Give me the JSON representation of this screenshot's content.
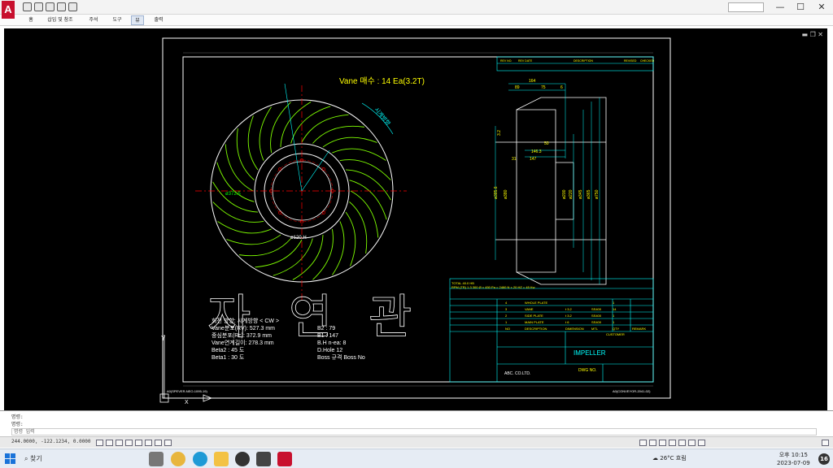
{
  "titlebar": {
    "logo": "A",
    "controls": [
      "—",
      "☐",
      "✕"
    ]
  },
  "ribbon": {
    "tabs": [
      "홈",
      "삽입 및 참조",
      "주석",
      "도구",
      "뷰",
      "출력"
    ],
    "active_tab": 4
  },
  "viewport": {
    "controls": "▬ ❐ ✕"
  },
  "drawing": {
    "vane_title": "Vane 매수 : 14 Ea(3.2T)",
    "rotation_label": "시계방향",
    "dim_labels": [
      "ø372.5",
      "ø120.H"
    ],
    "big_text_1": "자",
    "big_text_2": "연",
    "big_text_3": "관",
    "specs_left": [
      "회전 방향:      시계방향 < CW >",
      "Vane분포(RV):  527.3 mm",
      "중심분포(Rc):  372.9 mm",
      "Vane연계길이:  278.3 mm",
      "Beta2 :           45 도",
      "Beta1 :           30 도"
    ],
    "specs_right": [
      "B2 :           79",
      "B1 :           147",
      "B.H   n-ea:  8",
      "D.Hole        12",
      "Boss 규격     Boss No"
    ],
    "side_dims_top": [
      "164",
      "89",
      "75",
      "6"
    ],
    "side_dims_mid": [
      "50",
      "146.3",
      "31",
      "147",
      "3.2"
    ],
    "side_dims_v": [
      "ø385.6",
      "ø380",
      "ø200",
      "ø220",
      "ø345",
      "ø365",
      "ø750"
    ],
    "titleblock": {
      "company": "ABC. CO.LTD.",
      "drawing_title": "IMPELLER",
      "customer_label": "CUSTOMER",
      "dwg_no_label": "DWG NO.",
      "rev_header": [
        "REV NO.",
        "REV DATE",
        "DESCRIPTION",
        "REVISED",
        "CHECKED"
      ],
      "parts_header": [
        "NO",
        "DESCRIPTION",
        "DIMENSION",
        "MTL",
        "QTY",
        "REMARK"
      ],
      "parts": [
        [
          "4",
          "WHOLE PLATE",
          "",
          "",
          "1",
          ""
        ],
        [
          "3",
          "VANE",
          "t 3.2",
          "SS400",
          "14",
          ""
        ],
        [
          "2",
          "SIDE PLATE",
          "t 3.2",
          "SS400",
          "1",
          ""
        ],
        [
          "1",
          "MAIN PLATE",
          "t 6",
          "SS400",
          "1",
          ""
        ]
      ],
      "spec_line": "TOTAL  40.0   HB",
      "spec_line2": "RPM (TR)  1.3   300 Ø × 450 Pa = 2460 N × 20 HZ = 45 Kw",
      "footer_left": "A0(SPEVER-NEO-1095-19)",
      "footer_right": "A0(CONVEYOR-2041-02)"
    }
  },
  "command": {
    "history": [
      "명령:",
      "명령:"
    ],
    "placeholder": "명령 입력"
  },
  "status": {
    "coords": "244.0000, -122.1234, 0.0000"
  },
  "taskbar": {
    "search": "찾기",
    "weather": "26°C 흐림",
    "time": "오후 10:15",
    "date": "2023-07-09",
    "notif": "16"
  }
}
